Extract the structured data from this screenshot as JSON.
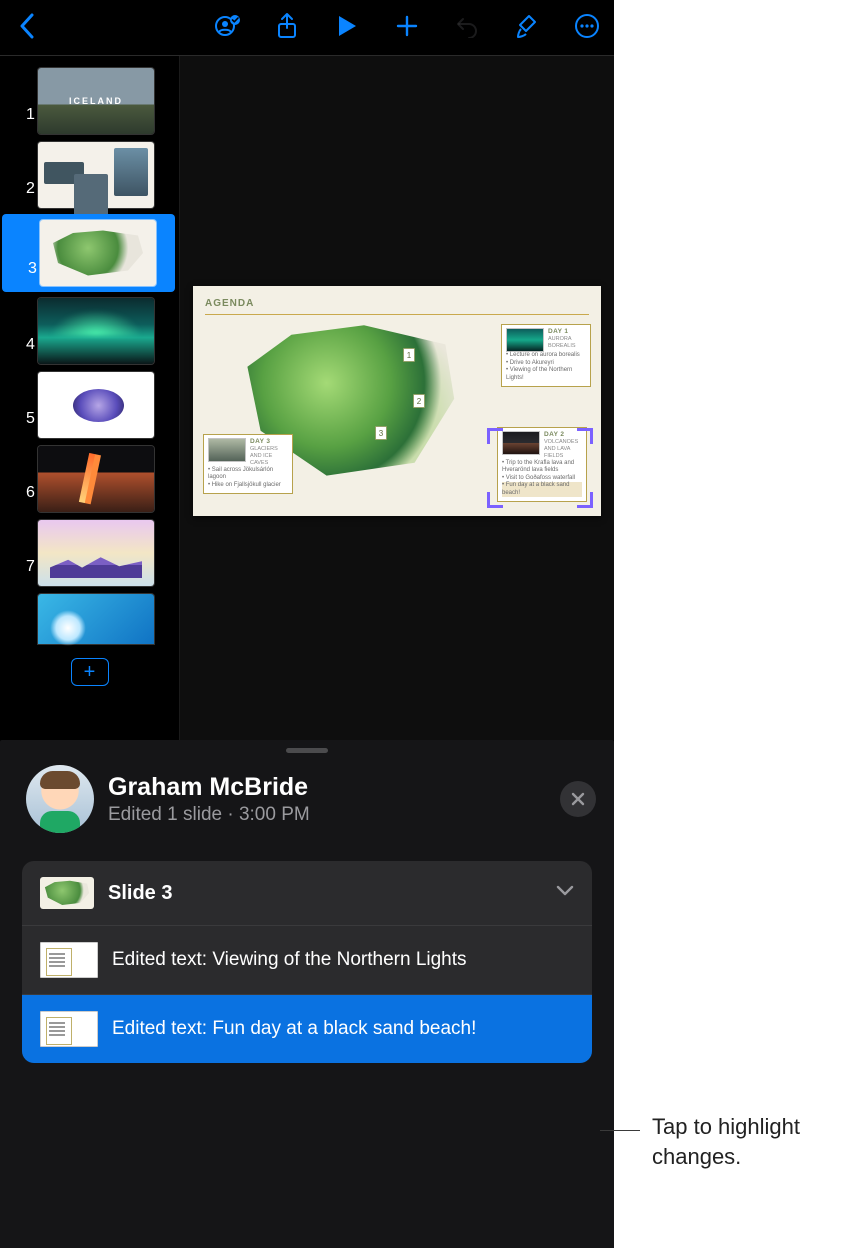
{
  "toolbar": {
    "icons": [
      "back",
      "collaborate",
      "share",
      "play",
      "add",
      "undo",
      "format",
      "more"
    ]
  },
  "navigator": {
    "slides": [
      {
        "num": "1",
        "label": "ICELAND"
      },
      {
        "num": "2"
      },
      {
        "num": "3"
      },
      {
        "num": "4"
      },
      {
        "num": "5"
      },
      {
        "num": "6"
      },
      {
        "num": "7"
      }
    ],
    "add_icon": "+"
  },
  "canvas": {
    "slide_title": "AGENDA",
    "pins": [
      "1",
      "2",
      "3"
    ],
    "day1": {
      "hdr": "DAY 1",
      "sub": "AURORA BOREALIS",
      "b1": "• Lecture on aurora borealis",
      "b2": "• Drive to Akureyri",
      "b3": "• Viewing of the Northern Lights!"
    },
    "day2": {
      "hdr": "DAY 2",
      "sub": "VOLCANOES AND LAVA FIELDS",
      "b1": "• Trip to the Krafla lava and Hverarönd lava fields",
      "b2": "• Visit to Goðafoss waterfall",
      "b3": "• Fun day at a black sand beach!"
    },
    "day3": {
      "hdr": "DAY 3",
      "sub": "GLACIERS AND ICE CAVES",
      "b1": "• Sail across Jökulsárlón lagoon",
      "b2": "• Hike on Fjallsjökull glacier"
    }
  },
  "sheet": {
    "user_name": "Graham McBride",
    "user_sub": "Edited 1 slide · 3:00 PM",
    "section_title": "Slide 3",
    "edits": [
      "Edited text: Viewing of the Northern Lights",
      "Edited text: Fun day at a black sand beach!"
    ]
  },
  "callout": "Tap to highlight changes."
}
